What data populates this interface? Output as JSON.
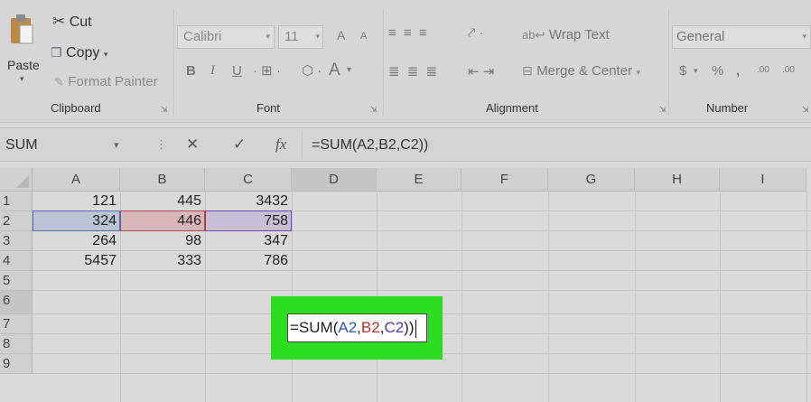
{
  "ribbon": {
    "clipboard": {
      "paste_label": "Paste",
      "cut_label": "Cut",
      "copy_label": "Copy",
      "format_painter_label": "Format Painter",
      "group_label": "Clipboard"
    },
    "font": {
      "font_name": "Calibri",
      "font_size": "11",
      "bold": "B",
      "italic": "I",
      "underline": "U",
      "font_color_label": "A",
      "grow_label": "A",
      "shrink_label": "A",
      "group_label": "Font"
    },
    "alignment": {
      "wrap_text_label": "Wrap Text",
      "merge_center_label": "Merge & Center",
      "group_label": "Alignment"
    },
    "number": {
      "format": "General",
      "currency": "$",
      "percent": "%",
      "comma": ",",
      "increase_decimal": ".00",
      "group_label": "Number"
    }
  },
  "formula_bar": {
    "name_box": "SUM",
    "cancel": "✕",
    "enter": "✓",
    "fx": "fx",
    "formula": "=SUM(A2,B2,C2))"
  },
  "grid": {
    "columns": [
      "A",
      "B",
      "C",
      "D",
      "E",
      "F",
      "G",
      "H",
      "I"
    ],
    "rows": [
      "1",
      "2",
      "3",
      "4",
      "5",
      "6",
      "7",
      "8",
      "9"
    ],
    "cells": [
      [
        "121",
        "445",
        "3432"
      ],
      [
        "324",
        "446",
        "758"
      ],
      [
        "264",
        "98",
        "347"
      ],
      [
        "5457",
        "333",
        "786"
      ]
    ]
  },
  "edit_cell": {
    "prefix": "=SUM(",
    "ref1": "A2",
    "comma1": ",",
    "ref2": "B2",
    "comma2": ",",
    "ref3": "C2",
    "suffix": "))"
  },
  "colors": {
    "highlight_green": "#2bdc1f",
    "ref_blue": "#2e56b8",
    "ref_red": "#b8302e",
    "ref_purple": "#6a2ea8"
  }
}
